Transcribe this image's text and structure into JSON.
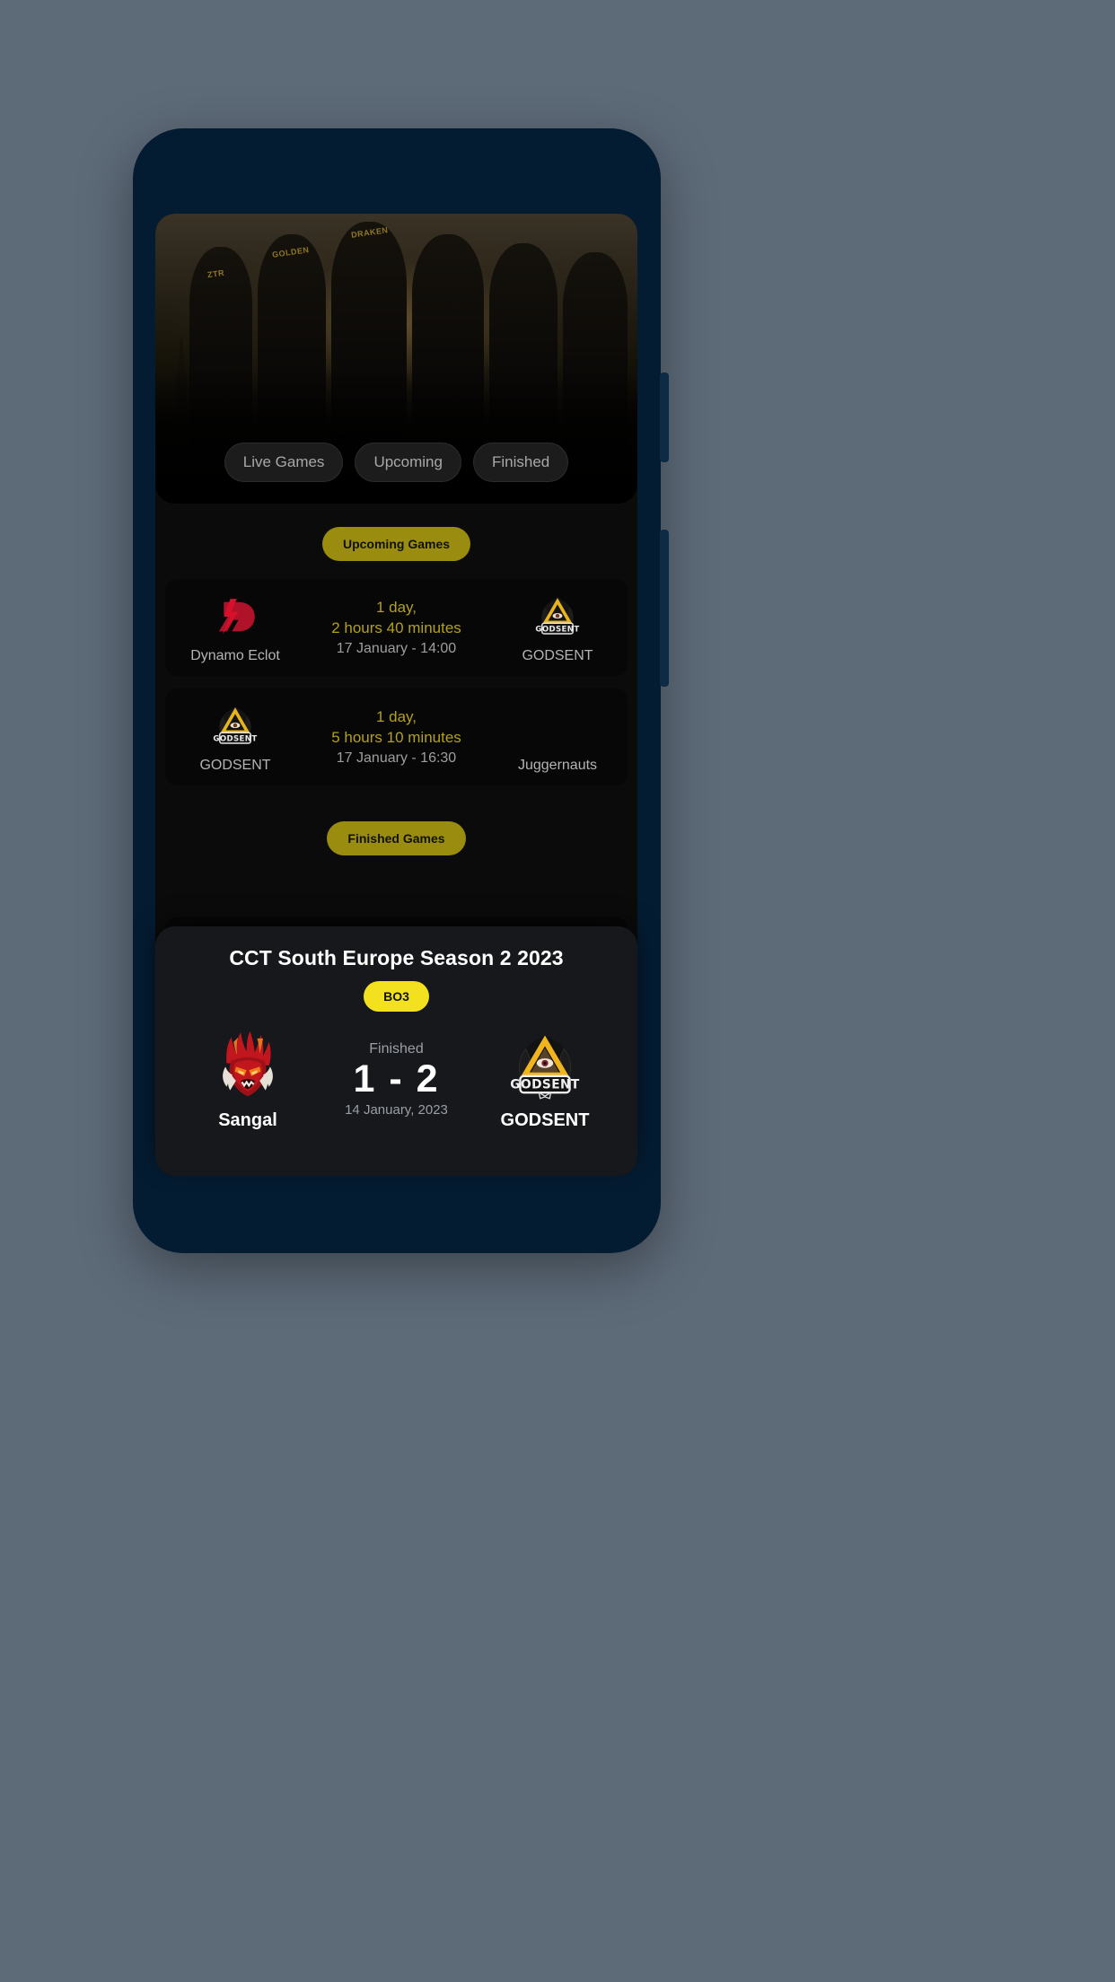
{
  "theme": {
    "page_background": "#5d6a78",
    "phone_frame": "#041c32",
    "screen_background": "#0b0b0b",
    "accent_yellow": "#f3e01f",
    "dim_yellow": "#9a8c0f",
    "countdown_yellow": "#b3a11a",
    "sheet_background": "#16181c"
  },
  "hero": {
    "name": "esports-team-silhouette-banner",
    "jersey_names": [
      "ZTR",
      "GOLDEN",
      "DRAKEN"
    ]
  },
  "filters": [
    {
      "label": "Live Games",
      "name": "filter-live-games"
    },
    {
      "label": "Upcoming",
      "name": "filter-upcoming"
    },
    {
      "label": "Finished",
      "name": "filter-finished"
    }
  ],
  "sections": {
    "upcoming_label": "Upcoming Games",
    "finished_label": "Finished Games"
  },
  "upcoming_matches": [
    {
      "home_team": "Dynamo Eclot",
      "home_logo": "dynamo-eclot-logo",
      "away_team": "GODSENT",
      "away_logo": "godsent-logo",
      "countdown_line1": "1 day,",
      "countdown_line2": "2 hours 40 minutes",
      "datetime": "17 January - 14:00"
    },
    {
      "home_team": "GODSENT",
      "home_logo": "godsent-logo",
      "away_team": "Juggernauts",
      "away_logo": "no-logo",
      "countdown_line1": "1 day,",
      "countdown_line2": "5 hours 10 minutes",
      "datetime": "17 January - 16:30"
    }
  ],
  "finished_match": {
    "tournament": "CCT South Europe Season 2 2023",
    "format_badge": "BO3",
    "status": "Finished",
    "score": "1 - 2",
    "date": "14 January, 2023",
    "home_team": "Sangal",
    "home_logo": "sangal-logo",
    "away_team": "GODSENT",
    "away_logo": "godsent-logo"
  }
}
